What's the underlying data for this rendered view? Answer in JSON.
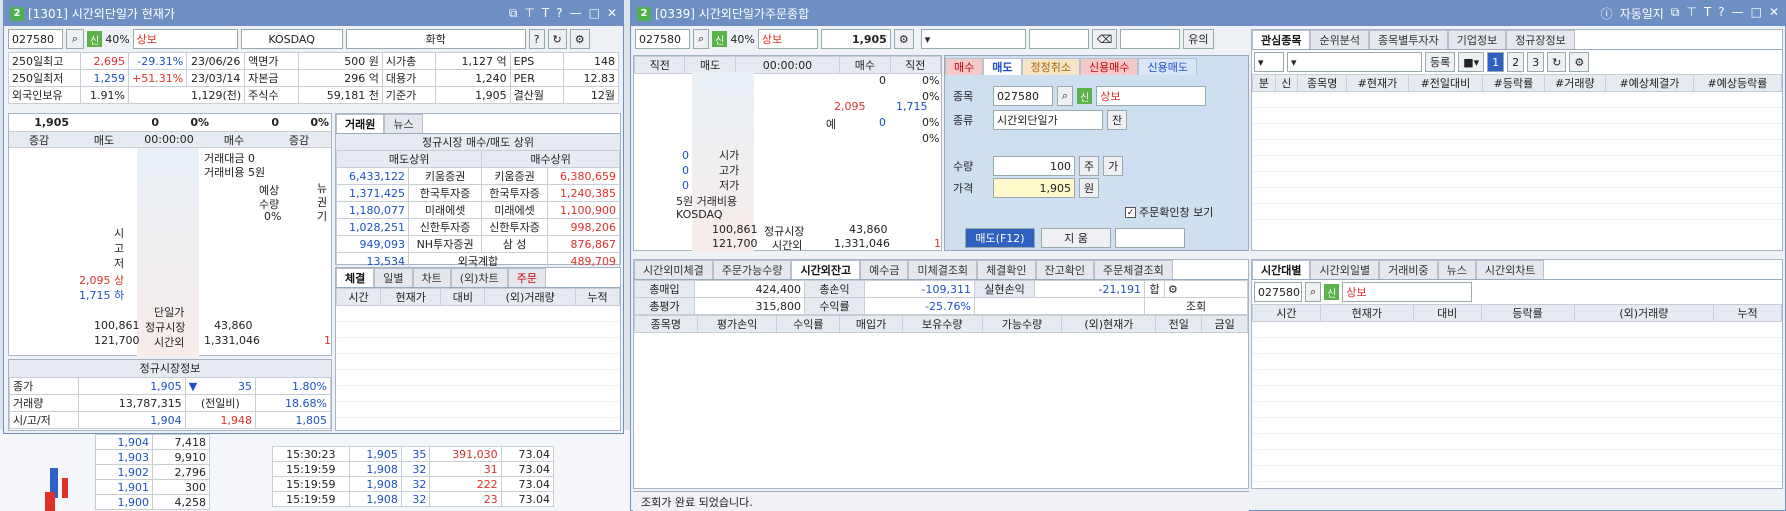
{
  "win1": {
    "num": "2",
    "title": "[1301] 시간외단일가 현재가",
    "code": "027580",
    "margin": "40%",
    "shin": "신",
    "name": "상보",
    "market": "KOSDAQ",
    "sector": "화학",
    "help": "?"
  },
  "info": {
    "r1": {
      "l": "250일최고",
      "v": "2,695",
      "p": "-29.31%",
      "d": "23/06/26",
      "k1": "액면가",
      "v1": "500 원",
      "k2": "시가총",
      "v2": "1,127 억",
      "k3": "EPS",
      "v3": "148"
    },
    "r2": {
      "l": "250일최저",
      "v": "1,259",
      "p": "+51.31%",
      "d": "23/03/14",
      "k1": "자본금",
      "v1": "296 억",
      "k2": "대용가",
      "v2": "1,240",
      "k3": "PER",
      "v3": "12.83"
    },
    "r3": {
      "l": "외국인보유",
      "v": "1.91%",
      "p": "1,129(천)",
      "k1": "주식수",
      "v1": "59,181 천",
      "k2": "기준가",
      "v2": "1,905",
      "k3": "결산월",
      "v3": "12월"
    }
  },
  "quote": {
    "price": "1,905",
    "chg": "0",
    "pct": "0%",
    "vol": "0",
    "vpct": "0%",
    "h_jg": "증감",
    "h_md": "매도",
    "h_time": "00:00:00",
    "h_ms": "매수",
    "h_jg2": "증감",
    "amt_l": "거래대금",
    "amt": "0",
    "fee_l": "거래비용",
    "fee": "5원",
    "exp_l": "예상",
    "exp_q": "수량",
    "exp_p": "0%",
    "news": [
      "뉴",
      "권",
      "기"
    ],
    "si": "시",
    "go": "고",
    "jeo": "저",
    "up": "2,095 상",
    "dn": "1,715 하",
    "sp_l": "단일가",
    "reg_l": "정규시장",
    "reg": "43,860",
    "ov_l": "시간외",
    "ov": "1,331,046",
    "t1": "100,861",
    "t2": "121,700",
    "one": "1"
  },
  "broker": {
    "tabs": [
      "거래원",
      "뉴스"
    ],
    "head": "정규시장 매수/매도 상위",
    "sell_h": "매도상위",
    "buy_h": "매수상위",
    "rows": [
      [
        "6,433,122",
        "키움증권",
        "키움증권",
        "6,380,659"
      ],
      [
        "1,371,425",
        "한국투자증",
        "한국투자증",
        "1,240,385"
      ],
      [
        "1,180,077",
        "미래에셋",
        "미래에셋",
        "1,100,900"
      ],
      [
        "1,028,251",
        "신한투자증",
        "신한투자증",
        "998,206"
      ],
      [
        "949,093",
        "NH투자증권",
        "삼 성",
        "876,867"
      ]
    ],
    "foreign": [
      "13,534",
      "외국계합",
      "489,709"
    ]
  },
  "exec": {
    "tabs": [
      "체결",
      "일별",
      "차트",
      "(외)차트",
      "주문"
    ],
    "cols": [
      "시간",
      "현재가",
      "대비",
      "(외)거래량",
      "누적"
    ]
  },
  "regular": {
    "title": "정규시장정보",
    "close_l": "종가",
    "close": "1,905",
    "arrow": "▼",
    "chg": "35",
    "pct": "1.80%",
    "vol_l": "거래량",
    "vol": "13,787,315",
    "prev_l": "(전일비)",
    "prev": "18.68%",
    "ohl_l": "시/고/저",
    "o": "1,904",
    "h": "1,948",
    "lo": "1,805"
  },
  "bg": {
    "rows": [
      [
        "1,904",
        "7,418"
      ],
      [
        "1,903",
        "9,910"
      ],
      [
        "1,902",
        "2,796"
      ],
      [
        "1,901",
        "300"
      ],
      [
        "1,900",
        "4,258"
      ]
    ],
    "ticks": [
      [
        "15:30:23",
        "1,905",
        "35",
        "391,030",
        "73.04"
      ],
      [
        "15:19:59",
        "1,908",
        "32",
        "31",
        "73.04"
      ],
      [
        "15:19:59",
        "1,908",
        "32",
        "222",
        "73.04"
      ],
      [
        "15:19:59",
        "1,908",
        "32",
        "23",
        "73.04"
      ]
    ]
  },
  "win2": {
    "num": "2",
    "title": "[0339] 시간외단일가주문종합",
    "code": "027580",
    "margin": "40%",
    "shin": "신",
    "name": "상보",
    "price": "1,905",
    "auto": "자동일지",
    "yui": "유의"
  },
  "ob": {
    "h": [
      "직전",
      "매도",
      "00:00:00",
      "매수",
      "직전"
    ],
    "zero": "0",
    "zp": "0%",
    "up": "2,095",
    "chg": "1,715",
    "ye": "예",
    "si": "시가",
    "go": "고가",
    "jeo": "저가",
    "dan": "5원",
    "fee": "거래비용",
    "mk": "KOSDAQ",
    "t1": "100,861",
    "t2": "121,700",
    "reg_l": "정규시장",
    "reg": "43,860",
    "ov_l": "시간외",
    "ov": "1,331,046",
    "one": "1"
  },
  "order": {
    "tabs": [
      "매수",
      "매도",
      "정정취소",
      "신용매수",
      "신용매도"
    ],
    "code_l": "종목",
    "code": "027580",
    "name": "상보",
    "type_l": "종류",
    "type": "시간외단일가",
    "jan": "잔",
    "qty_l": "수량",
    "qty": "100",
    "ju": "주",
    "ga": "가",
    "price_l": "가격",
    "price": "1,905",
    "won": "원",
    "confirm": "주문확인창 보기",
    "submit": "매도(F12)",
    "clear": "지 움"
  },
  "watch": {
    "tabs": [
      "관심종목",
      "순위분석",
      "종목별투자자",
      "기업정보",
      "정규장정보"
    ],
    "reg": "등록",
    "pages": [
      "1",
      "2",
      "3"
    ],
    "cols": [
      "분",
      "신",
      "종목명",
      "#현재가",
      "#전일대비",
      "#등락률",
      "#거래량",
      "#예상체결가",
      "#예상등락률"
    ]
  },
  "bal": {
    "tabs": [
      "시간외미체결",
      "주문가능수량",
      "시간외잔고",
      "예수금",
      "미체결조회",
      "체결확인",
      "잔고확인",
      "주문체결조회"
    ],
    "buy_l": "총매입",
    "buy": "424,400",
    "pl_l": "총손익",
    "pl": "-109,311",
    "real_l": "실현손익",
    "real": "-21,191",
    "hap": "합",
    "eval_l": "총평가",
    "eval": "315,800",
    "ret_l": "수익률",
    "ret": "-25.76%",
    "query": "조회",
    "cols": [
      "종목명",
      "평가손익",
      "수익률",
      "매입가",
      "보유수량",
      "가능수량",
      "(외)현재가",
      "전일",
      "금일"
    ],
    "status": "조회가 완료 되었습니다."
  },
  "tick": {
    "tabs": [
      "시간대별",
      "시간외일별",
      "거래비중",
      "뉴스",
      "시간외차트"
    ],
    "code": "027580",
    "name": "상보",
    "cols": [
      "시간",
      "현재가",
      "대비",
      "등락률",
      "(외)거래량",
      "누적"
    ]
  }
}
